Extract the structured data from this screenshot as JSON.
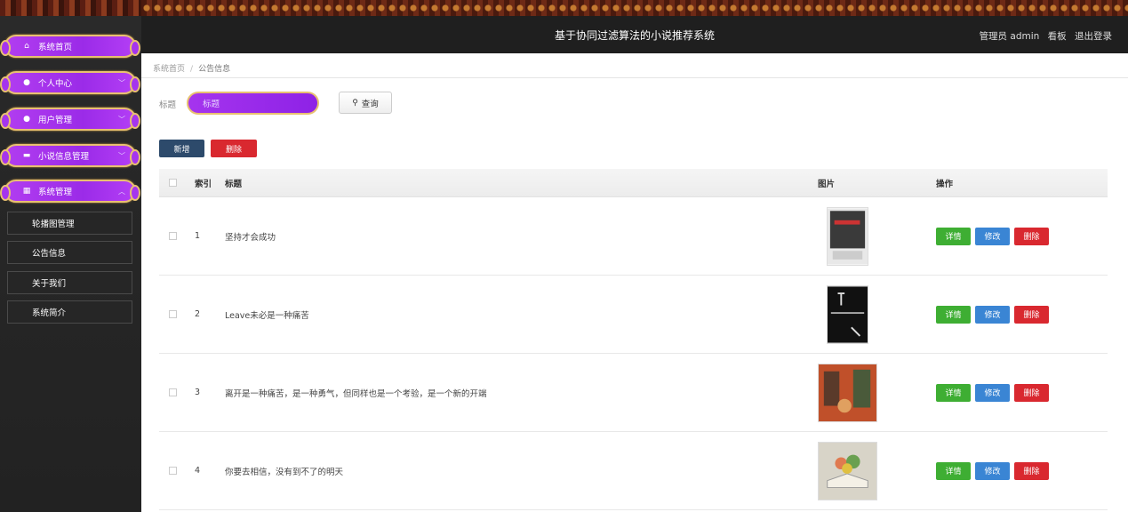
{
  "header": {
    "title": "基于协同过滤算法的小说推荐系统",
    "user_role": "管理员 admin",
    "dashboard": "看板",
    "logout": "退出登录"
  },
  "sidebar": {
    "items": [
      {
        "label": "系统首页",
        "icon": "home-icon"
      },
      {
        "label": "个人中心",
        "icon": "user-icon"
      },
      {
        "label": "用户管理",
        "icon": "user-icon"
      },
      {
        "label": "小说信息管理",
        "icon": "chat-icon"
      },
      {
        "label": "系统管理",
        "icon": "grid-icon"
      }
    ],
    "sub_items": [
      "轮播图管理",
      "公告信息",
      "关于我们",
      "系统简介"
    ]
  },
  "breadcrumb": {
    "home": "系统首页",
    "separator": "/",
    "current": "公告信息"
  },
  "search": {
    "label": "标题",
    "placeholder": "标题",
    "button": "查询"
  },
  "actions": {
    "add": "新增",
    "delete": "删除"
  },
  "table": {
    "columns": {
      "index": "索引",
      "title": "标题",
      "image": "图片",
      "ops": "操作"
    },
    "ops": {
      "detail": "详情",
      "edit": "修改",
      "delete": "删除"
    },
    "rows": [
      {
        "index": "1",
        "title": "坚持才会成功"
      },
      {
        "index": "2",
        "title": "Leave未必是一种痛苦"
      },
      {
        "index": "3",
        "title": "离开是一种痛苦，是一种勇气，但同样也是一个考验，是一个新的开端"
      },
      {
        "index": "4",
        "title": "你要去相信，没有到不了的明天"
      }
    ]
  },
  "colors": {
    "menu_purple": "#9b2be8",
    "menu_border": "#e8c070",
    "primary_dark": "#2d4a6b",
    "danger": "#d9282f",
    "success": "#3eae33",
    "info": "#3a85d4"
  }
}
